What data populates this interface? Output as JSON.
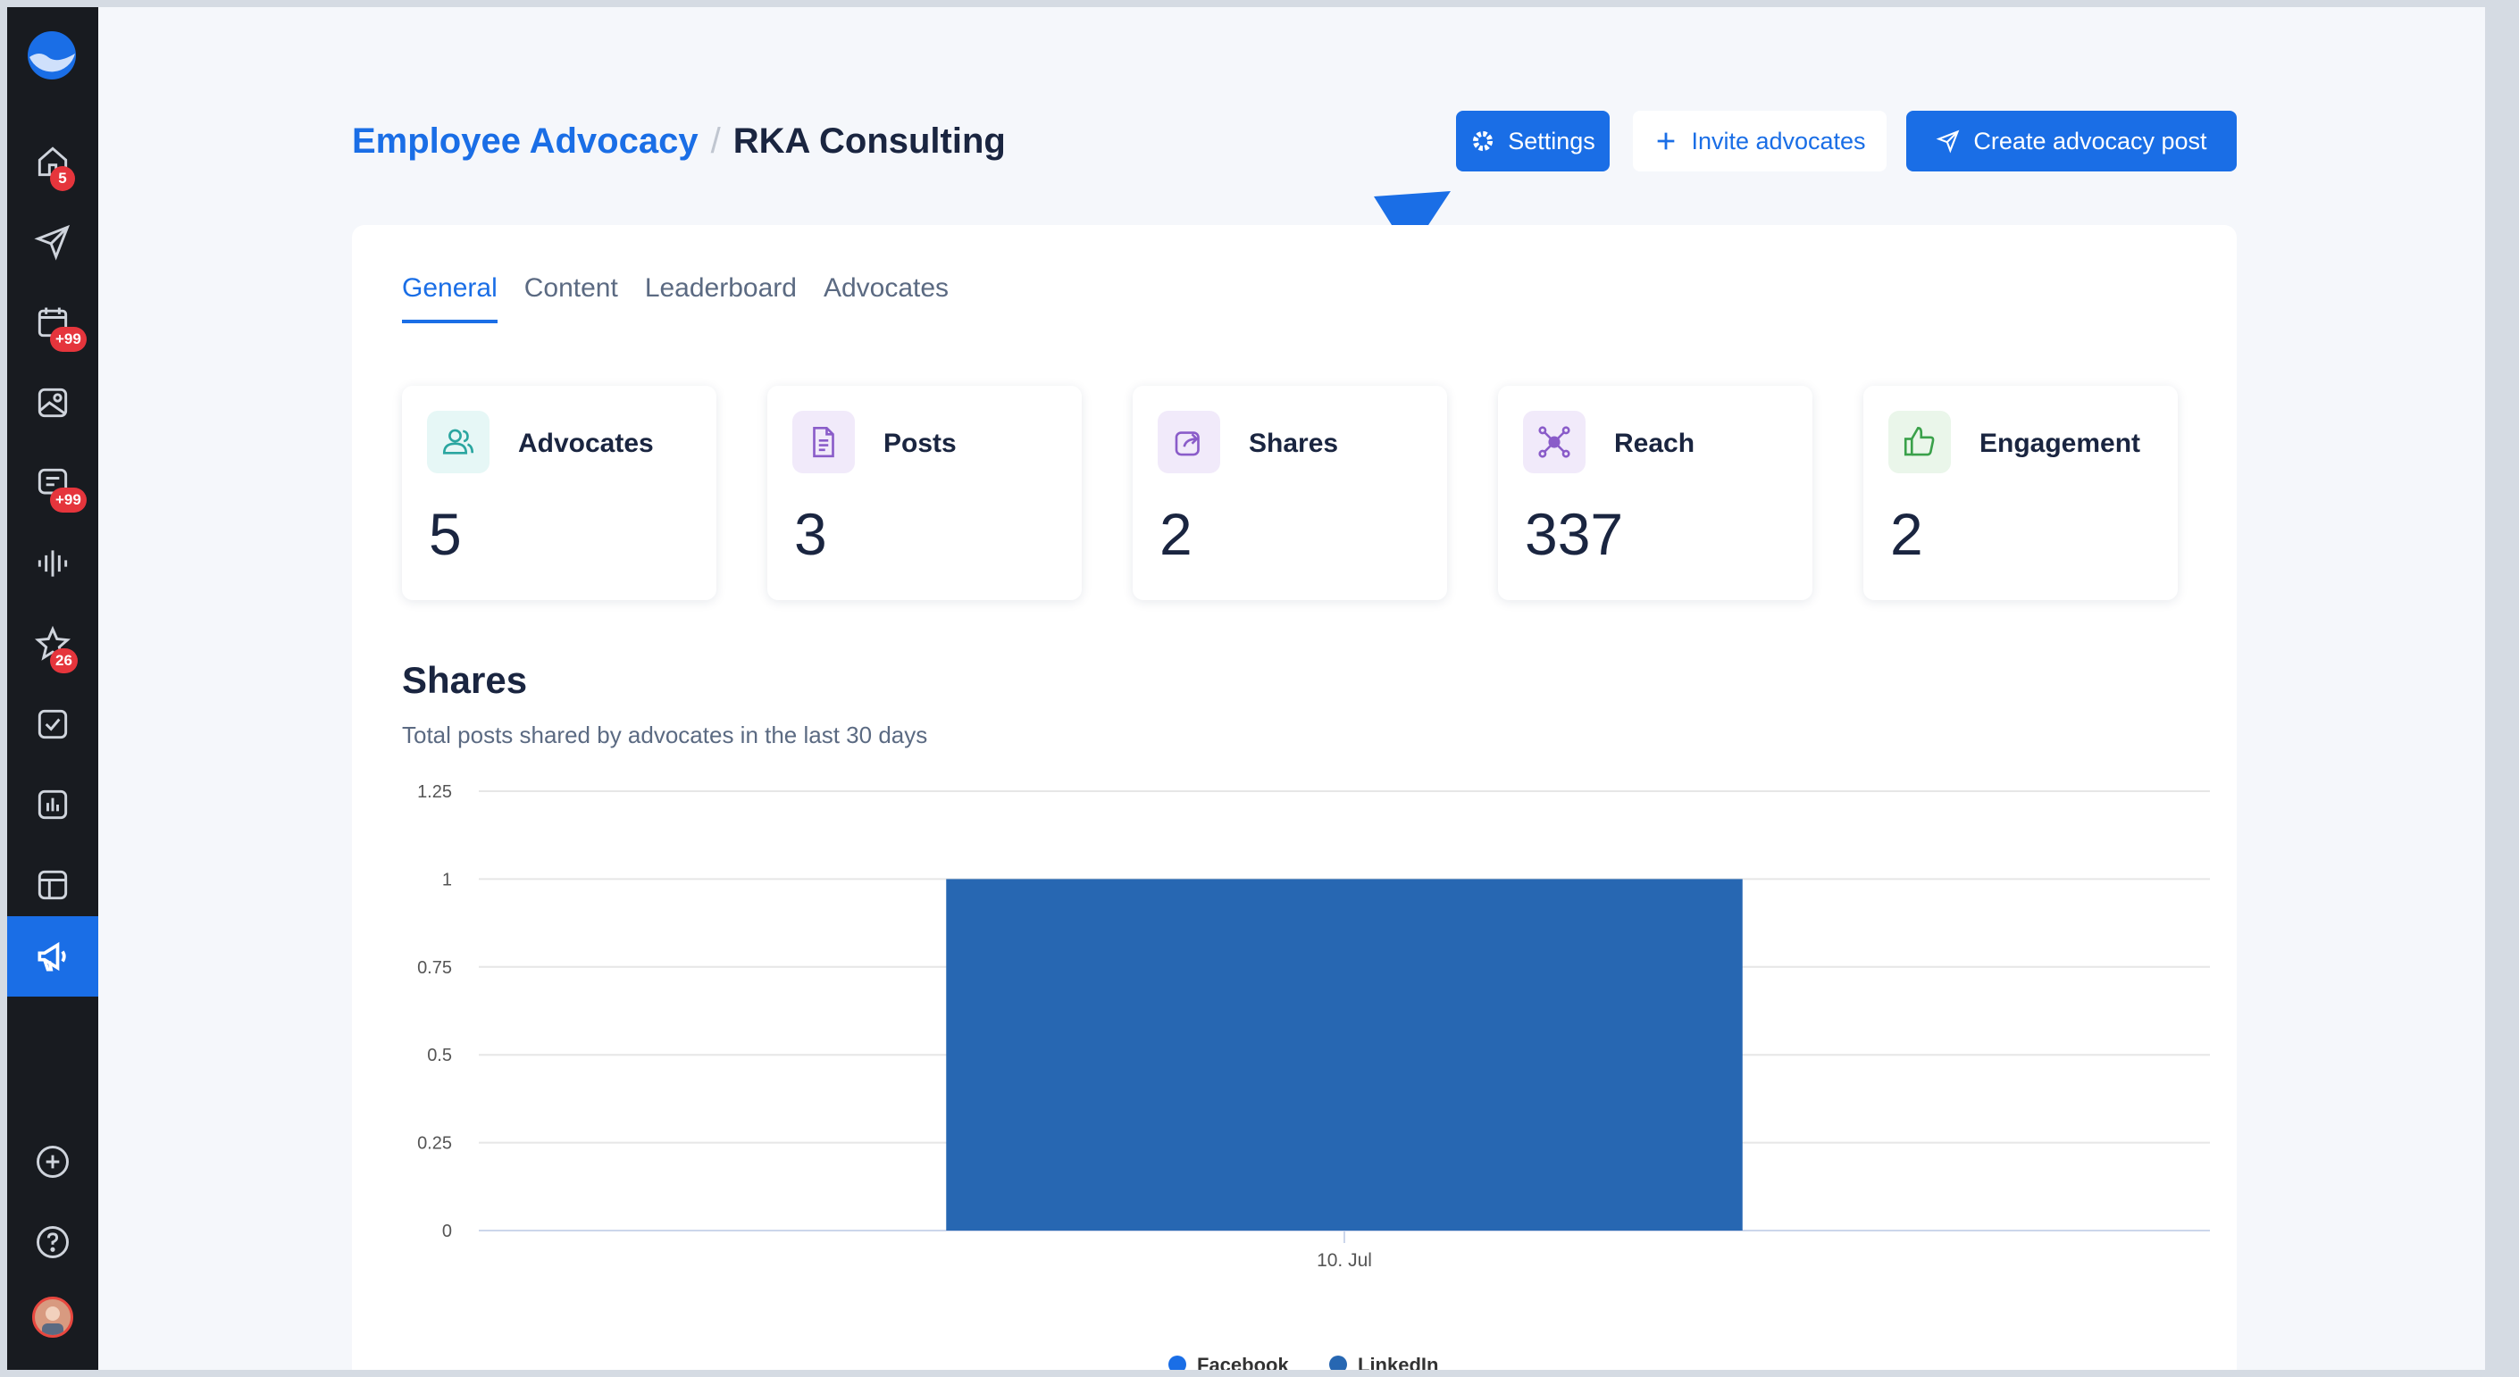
{
  "sidebar": {
    "badges": {
      "home": "5",
      "calendar": "+99",
      "inbox": "+99",
      "reviews": "26"
    },
    "items": [
      "home-icon",
      "send-icon",
      "calendar-icon",
      "media-icon",
      "inbox-icon",
      "listening-icon",
      "reviews-icon",
      "tasks-icon",
      "reports-icon",
      "layout-icon",
      "megaphone-icon",
      "add-icon",
      "help-icon"
    ]
  },
  "header": {
    "breadcrumb_parent": "Employee Advocacy",
    "breadcrumb_separator": "/",
    "breadcrumb_current": "RKA Consulting",
    "settings_label": "Settings",
    "invite_label": "Invite advocates",
    "create_label": "Create advocacy post"
  },
  "tabs": [
    "General",
    "Content",
    "Leaderboard",
    "Advocates"
  ],
  "stats": [
    {
      "label": "Advocates",
      "value": "5",
      "icon": "users-icon",
      "bg": "#e6f7f6",
      "color": "#2aa6a0"
    },
    {
      "label": "Posts",
      "value": "3",
      "icon": "document-icon",
      "bg": "#f1eafa",
      "color": "#8a5cc9"
    },
    {
      "label": "Shares",
      "value": "2",
      "icon": "share-icon",
      "bg": "#f1eafa",
      "color": "#8a5cc9"
    },
    {
      "label": "Reach",
      "value": "337",
      "icon": "network-icon",
      "bg": "#f1eafa",
      "color": "#8a5cc9"
    },
    {
      "label": "Engagement",
      "value": "2",
      "icon": "thumbs-up-icon",
      "bg": "#eaf6ea",
      "color": "#3aa14a"
    }
  ],
  "shares_section": {
    "title": "Shares",
    "subtitle": "Total posts shared by advocates in the last 30 days"
  },
  "chart_data": {
    "type": "bar",
    "categories": [
      "10. Jul"
    ],
    "series": [
      {
        "name": "Facebook",
        "values": [
          0
        ],
        "color": "#1a6ee6"
      },
      {
        "name": "LinkedIn",
        "values": [
          1
        ],
        "color": "#2767b2"
      }
    ],
    "ylim": [
      0,
      1.25
    ],
    "yticks": [
      "0",
      "0.25",
      "0.5",
      "0.75",
      "1",
      "1.25"
    ],
    "grid": true,
    "legend": "bottom"
  },
  "colors": {
    "accent": "#1a6ee6",
    "sidebar": "#181b20",
    "bar": "#2767b2"
  }
}
